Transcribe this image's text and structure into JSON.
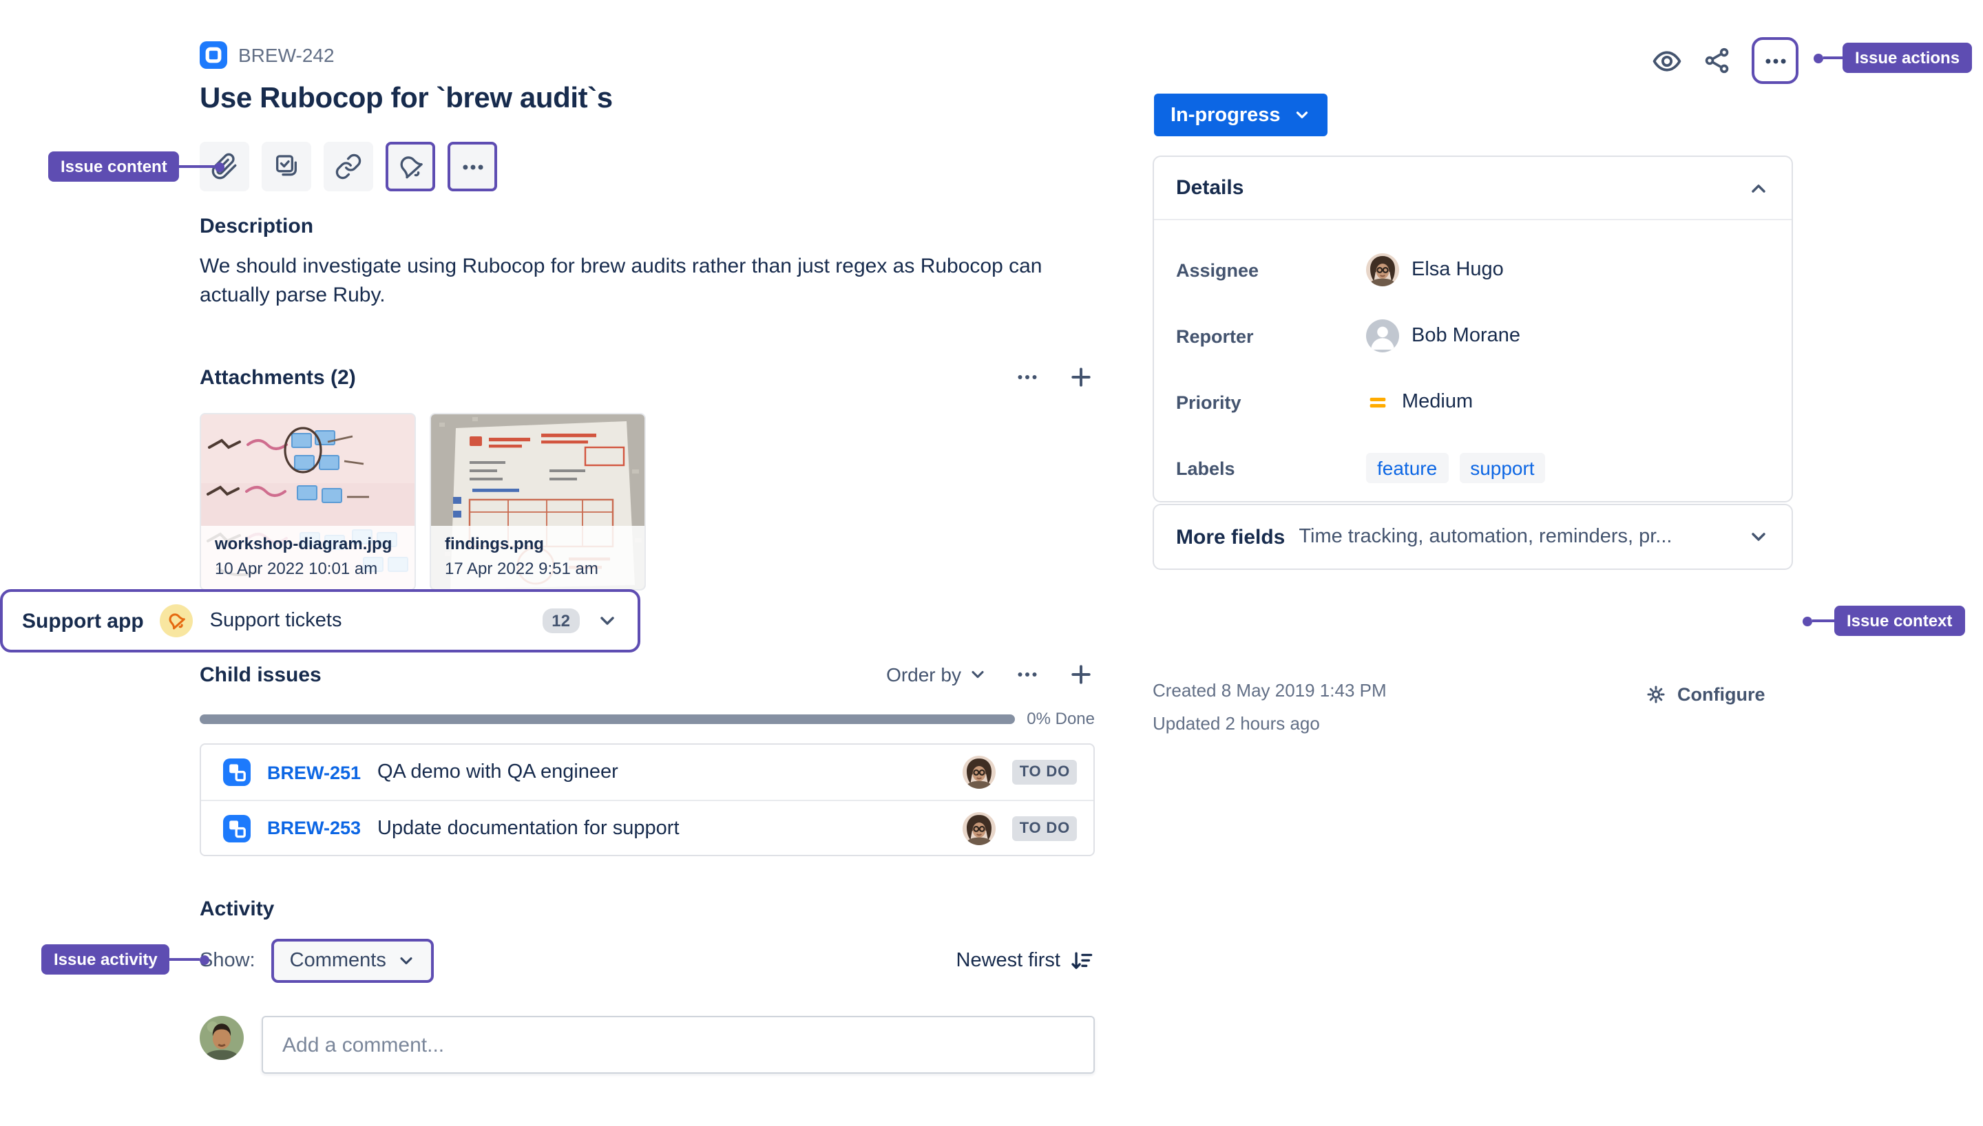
{
  "annotations": {
    "content": "Issue content",
    "actions": "Issue actions",
    "context": "Issue context",
    "activity": "Issue activity"
  },
  "header": {
    "issue_key": "BREW-242",
    "title": "Use Rubocop for `brew audit`s"
  },
  "status": {
    "label": "In-progress"
  },
  "description": {
    "heading": "Description",
    "body": "We should investigate using Rubocop for brew audits rather than just regex as Rubocop can actually parse Ruby."
  },
  "attachments": {
    "heading": "Attachments (2)",
    "items": [
      {
        "name": "workshop-diagram.jpg",
        "date": "10 Apr 2022 10:01 am"
      },
      {
        "name": "findings.png",
        "date": "17 Apr 2022 9:51 am"
      }
    ]
  },
  "child_issues": {
    "heading": "Child issues",
    "order_by": "Order by",
    "progress_label": "0% Done",
    "items": [
      {
        "key": "BREW-251",
        "summary": "QA demo with QA engineer",
        "status": "TO DO"
      },
      {
        "key": "BREW-253",
        "summary": "Update documentation for support",
        "status": "TO DO"
      }
    ]
  },
  "activity": {
    "heading": "Activity",
    "show_label": "Show:",
    "filter_value": "Comments",
    "sort_label": "Newest first",
    "comment_placeholder": "Add a comment..."
  },
  "details": {
    "heading": "Details",
    "assignee_label": "Assignee",
    "assignee": "Elsa Hugo",
    "reporter_label": "Reporter",
    "reporter": "Bob Morane",
    "priority_label": "Priority",
    "priority": "Medium",
    "labels_label": "Labels",
    "labels": [
      "feature",
      "support"
    ]
  },
  "more_fields": {
    "heading": "More fields",
    "summary": "Time tracking, automation, reminders, pr..."
  },
  "support_app": {
    "heading": "Support app",
    "label": "Support tickets",
    "count": "12"
  },
  "meta": {
    "created": "Created 8 May 2019 1:43 PM",
    "updated": "Updated 2 hours ago",
    "configure": "Configure"
  },
  "icons": {
    "watch": "eye",
    "share": "share-nodes",
    "issue_actions": "ellipsis",
    "attach": "paperclip",
    "child_issue": "checklist",
    "link": "chain",
    "support": "bell",
    "more": "ellipsis",
    "add": "plus",
    "configure": "gear",
    "sort": "arrow-down-lines",
    "priority_medium": "orange-equals"
  },
  "colors": {
    "accent_blue": "#0C66E4",
    "annotation_purple": "#5E4DB2",
    "priority_medium": "#FFAB00",
    "support_icon_bg": "#F8E6A0",
    "support_icon": "#E56910",
    "link_blue": "#0C66E4",
    "issue_type_blue": "#1D7AFC",
    "progress_track": "#8590A2"
  }
}
